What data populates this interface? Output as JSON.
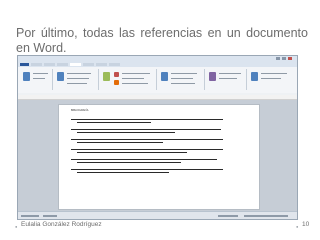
{
  "slide": {
    "title": "Por último, todas las referencias en un documento en Word.",
    "footer_author": "Eulalia González Rodríguez",
    "page_number": "10",
    "bullet_glyph": "●"
  },
  "word": {
    "page_heading": "BIBLIOGRAFÍA"
  }
}
